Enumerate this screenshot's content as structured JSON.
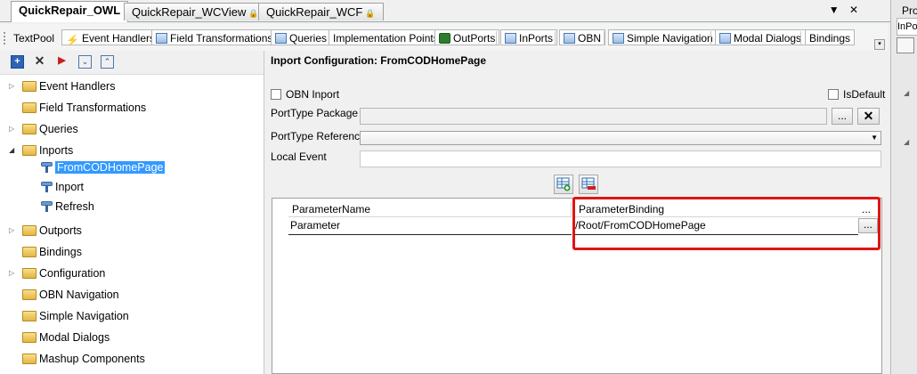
{
  "tabs": [
    {
      "label": "QuickRepair_OWL",
      "active": true,
      "locked": false
    },
    {
      "label": "QuickRepair_WCView",
      "active": false,
      "locked": true
    },
    {
      "label": "QuickRepair_WCF",
      "active": false,
      "locked": true
    }
  ],
  "tab_controls": {
    "dropdown": "▼",
    "close": "✕"
  },
  "toolbar": {
    "items": [
      "TextPool",
      "Event Handlers",
      "Field Transformations",
      "Queries",
      "Implementation Points",
      "OutPorts",
      "InPorts",
      "OBN",
      "Simple Navigation",
      "Modal Dialogs",
      "Bindings"
    ]
  },
  "left_tools": [
    "add",
    "delete",
    "execute",
    "expand-all",
    "collapse-all"
  ],
  "tree": {
    "items": [
      {
        "label": "Event Handlers",
        "level": 0,
        "expander": "right"
      },
      {
        "label": "Field Transformations",
        "level": 0,
        "expander": ""
      },
      {
        "label": "Queries",
        "level": 0,
        "expander": "right"
      },
      {
        "label": "Inports",
        "level": 0,
        "expander": "down"
      },
      {
        "label": "FromCODHomePage",
        "level": 1,
        "selected": true
      },
      {
        "label": "Inport",
        "level": 1
      },
      {
        "label": "Refresh",
        "level": 1
      },
      {
        "label": "Outports",
        "level": 0,
        "expander": "right"
      },
      {
        "label": "Bindings",
        "level": 0,
        "expander": ""
      },
      {
        "label": "Configuration",
        "level": 0,
        "expander": "right"
      },
      {
        "label": "OBN Navigation",
        "level": 0,
        "expander": ""
      },
      {
        "label": "Simple Navigation",
        "level": 0,
        "expander": ""
      },
      {
        "label": "Modal Dialogs",
        "level": 0,
        "expander": ""
      },
      {
        "label": "Mashup Components",
        "level": 0,
        "expander": ""
      }
    ]
  },
  "config": {
    "title": "Inport Configuration: FromCODHomePage",
    "obn_inport_label": "OBN Inport",
    "obn_inport_checked": false,
    "isdefault_label": "IsDefault",
    "isdefault_checked": false,
    "porttype_package_label": "PortType Package",
    "porttype_package_value": "",
    "browse_button": "...",
    "clear_button": "✕",
    "porttype_reference_label": "PortType Reference",
    "porttype_reference_value": "",
    "local_event_label": "Local Event",
    "local_event_value": ""
  },
  "grid": {
    "columns": [
      "ParameterName",
      "ParameterBinding"
    ],
    "header_button": "...",
    "rows": [
      {
        "name": "Parameter",
        "binding": "/Root/FromCODHomePage",
        "button": "..."
      }
    ]
  },
  "far_right": {
    "title": "Pro",
    "field": "InPo"
  }
}
